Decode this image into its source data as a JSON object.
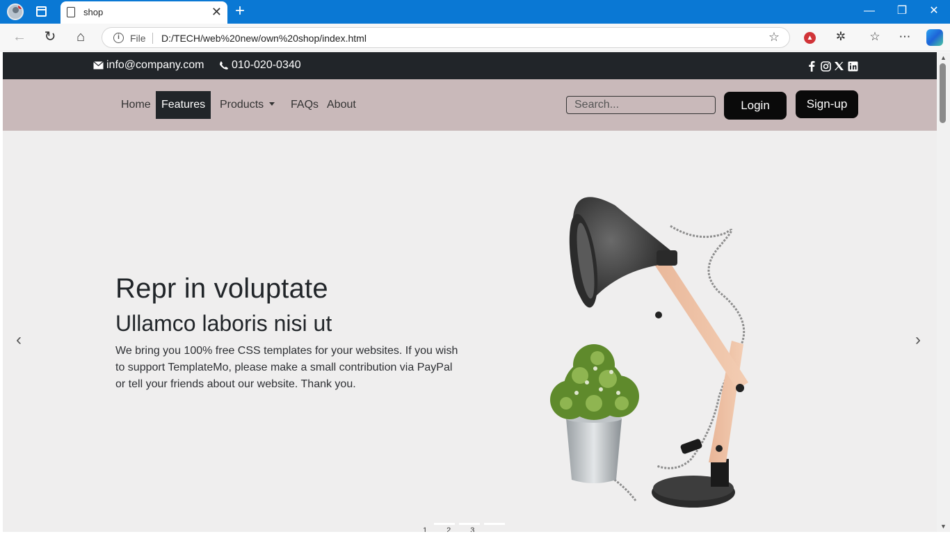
{
  "browser": {
    "tab_title": "shop",
    "address_scheme": "File",
    "url": "D:/TECH/web%20new/own%20shop/index.html"
  },
  "site": {
    "email": "info@company.com",
    "phone": "010-020-0340",
    "social_icons": [
      "facebook-icon",
      "instagram-icon",
      "x-icon",
      "linkedin-icon"
    ],
    "nav": {
      "home": "Home",
      "features": "Features",
      "products": "Products",
      "faqs": "FAQs",
      "about": "About"
    },
    "search_placeholder": "Search...",
    "login": "Login",
    "signup": "Sign-up",
    "colors": {
      "topbar": "#212529",
      "navbar": "#c9b9ba",
      "hero_bg": "#efeeee",
      "button": "#0a0a0a"
    }
  },
  "hero": {
    "title": "Repr in voluptate",
    "subtitle": "Ullamco laboris nisi ut",
    "text": "We bring you 100% free CSS templates for your websites. If you wish to support TemplateMo, please make a small contribution via PayPal or tell your friends about our website. Thank you.",
    "slides": [
      "1",
      "2",
      "3"
    ],
    "prev": "‹",
    "next": "›"
  }
}
